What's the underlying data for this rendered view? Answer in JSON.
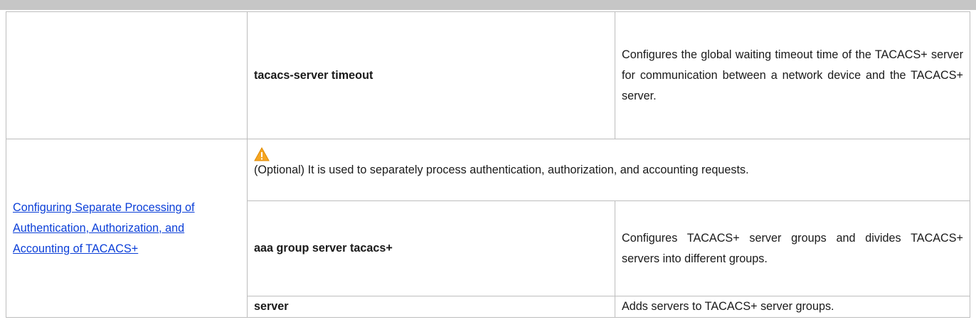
{
  "rows": [
    {
      "section": "",
      "command": "tacacs-server timeout",
      "description": "Configures the global waiting timeout time of the TACACS+ server for communication between a network device and the TACACS+ server."
    }
  ],
  "section2": {
    "link_text": "Configuring Separate Processing of Authentication, Authorization, and Accounting of TACACS+",
    "note": {
      "icon": "warning-icon",
      "text": "(Optional) It is used to separately process authentication, authorization, and accounting requests."
    },
    "commands": [
      {
        "command": "aaa group server tacacs+",
        "description": "Configures TACACS+ server groups and divides TACACS+ servers into different groups."
      },
      {
        "command": "server",
        "description": "Adds servers to TACACS+ server groups."
      }
    ]
  },
  "colors": {
    "link": "#0b3fd8",
    "warning_fill": "#f5a623",
    "header_bar": "#c6c6c6"
  }
}
